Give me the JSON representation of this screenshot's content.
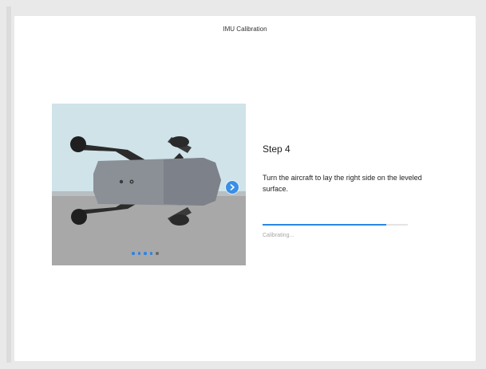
{
  "header": {
    "title": "IMU Calibration"
  },
  "illustration": {
    "icon": "aircraft-image",
    "next_icon": "chevron-right-icon",
    "pager": {
      "total": 5,
      "current": 4
    }
  },
  "step": {
    "title": "Step 4",
    "instruction": "Turn the aircraft to lay the right side on the leveled surface."
  },
  "progress": {
    "fraction": 0.85,
    "status": "Calibrating..."
  },
  "colors": {
    "accent": "#2a88e2",
    "sky": "#cfe3e9",
    "floor": "#a8a8a8",
    "aircraft": "#8b8f96"
  }
}
